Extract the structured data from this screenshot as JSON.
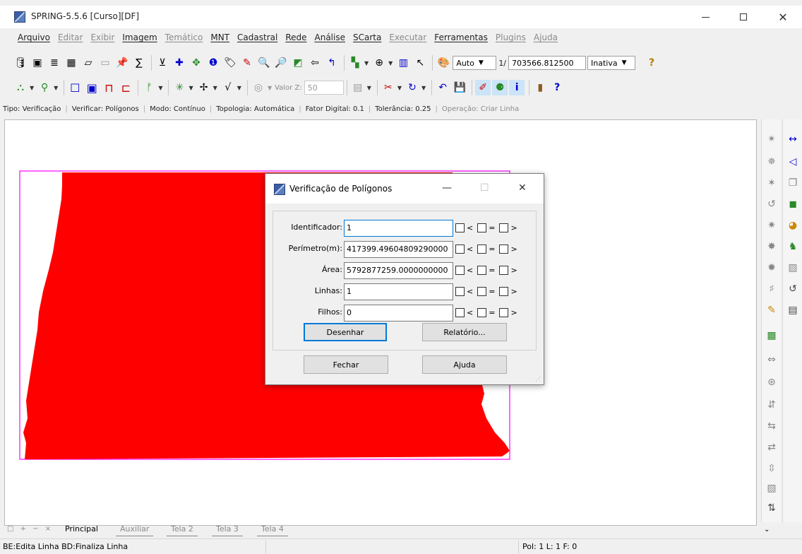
{
  "window": {
    "title": "SPRING-5.5.6 [Curso][DF]"
  },
  "menu": [
    {
      "label": "Arquivo",
      "enabled": true
    },
    {
      "label": "Editar",
      "enabled": false
    },
    {
      "label": "Exibir",
      "enabled": false
    },
    {
      "label": "Imagem",
      "enabled": true
    },
    {
      "label": "Temático",
      "enabled": false
    },
    {
      "label": "MNT",
      "enabled": true
    },
    {
      "label": "Cadastral",
      "enabled": true
    },
    {
      "label": "Rede",
      "enabled": true
    },
    {
      "label": "Análise",
      "enabled": true
    },
    {
      "label": "SCarta",
      "enabled": true
    },
    {
      "label": "Executar",
      "enabled": false
    },
    {
      "label": "Ferramentas",
      "enabled": true
    },
    {
      "label": "Plugins",
      "enabled": false
    },
    {
      "label": "Ajuda",
      "enabled": false
    }
  ],
  "toolbar1": {
    "scale_mode": "Auto",
    "scale_prefix": "1/",
    "scale_value": "703566.812500",
    "state": "Inativa",
    "help_icon": "?"
  },
  "toolbar2": {
    "value_z_label": "Valor Z:",
    "value_z": "50"
  },
  "infobar": [
    {
      "text": "Tipo: Verificação",
      "enabled": true
    },
    {
      "text": "Verificar: Polígonos",
      "enabled": true
    },
    {
      "text": "Modo: Contínuo",
      "enabled": true
    },
    {
      "text": "Topologia: Automática",
      "enabled": true
    },
    {
      "text": "Fator Digital: 0.1",
      "enabled": true
    },
    {
      "text": "Tolerância: 0.25",
      "enabled": true
    },
    {
      "text": "Operação: Criar Linha",
      "enabled": false
    }
  ],
  "tabs": {
    "nav": "□ + − ×",
    "items": [
      "Principal",
      "Auxiliar",
      "Tela 2",
      "Tela 3",
      "Tela 4"
    ],
    "active": "Principal"
  },
  "status": {
    "left": "BE:Edita Linha  BD:Finaliza Linha",
    "right": "Pol: 1 L: 1 F: 0"
  },
  "dialog": {
    "title": "Verificação de Polígonos",
    "fields": [
      {
        "label": "Identificador:",
        "value": "1"
      },
      {
        "label": "Perímetro(m):",
        "value": "417399.49604809290000"
      },
      {
        "label": "Área:",
        "value": "5792877259.0000000000"
      },
      {
        "label": "Linhas:",
        "value": "1"
      },
      {
        "label": "Filhos:",
        "value": "0"
      }
    ],
    "compare_ops": [
      "<",
      "=",
      ">"
    ],
    "draw_button": "Desenhar",
    "report_button": "Relatório...",
    "close_button": "Fechar",
    "help_button": "Ajuda"
  },
  "colors": {
    "polygon_fill": "#ff0000",
    "polygon_border": "#ff00ff",
    "focus": "#0078d7"
  }
}
